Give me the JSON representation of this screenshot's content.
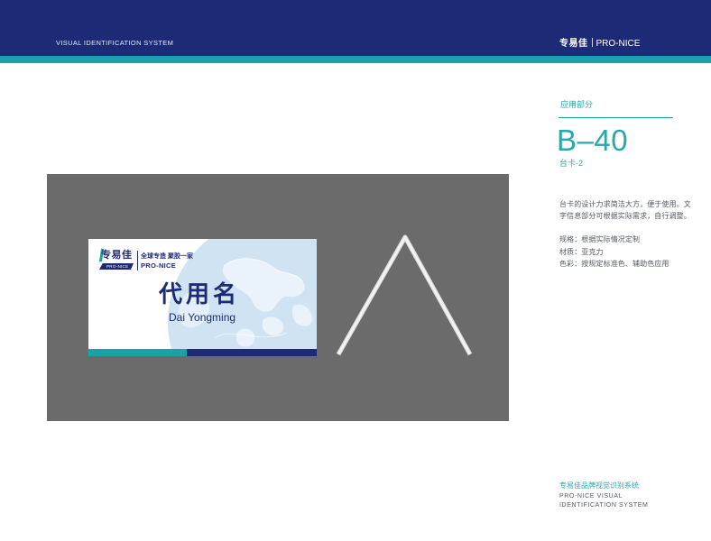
{
  "header": {
    "left_text": "VISUAL IDENTIFICATION SYSTEM",
    "brand_cn": "专易佳",
    "brand_en": "PRO-NICE"
  },
  "section": {
    "label": "应用部分",
    "code": "B–40",
    "title": "台卡-2"
  },
  "description": {
    "lines": [
      "台卡的设计力求简洁大方，便于使用。文",
      "字信息部分可根据实际需求，自行调整。"
    ]
  },
  "specs": [
    "规格：根据实际情况定制",
    "材质：亚克力",
    "色彩：按规定标准色、辅助色应用"
  ],
  "card": {
    "logo_cn": "专易佳",
    "logo_en": "PRO-NICE",
    "tagline": "全球专造  聚胶一家",
    "tagline_en": "PRO-NICE",
    "name_cn": "代用名",
    "name_en": "Dai Yongming"
  },
  "footer": {
    "cn": "专易佳品牌视觉识别系统",
    "en_line1": "PRO-NICE VISUAL",
    "en_line2": "IDENTIFICATION SYSTEM"
  },
  "graphics": {
    "globe": "globe-graphic",
    "stand": "a-frame-stand-graphic"
  },
  "colors": {
    "navy": "#1d2b76",
    "teal": "#1aa2a8",
    "panel_gray": "#6b6b6b",
    "globe_blue": "#cfe3f3"
  }
}
